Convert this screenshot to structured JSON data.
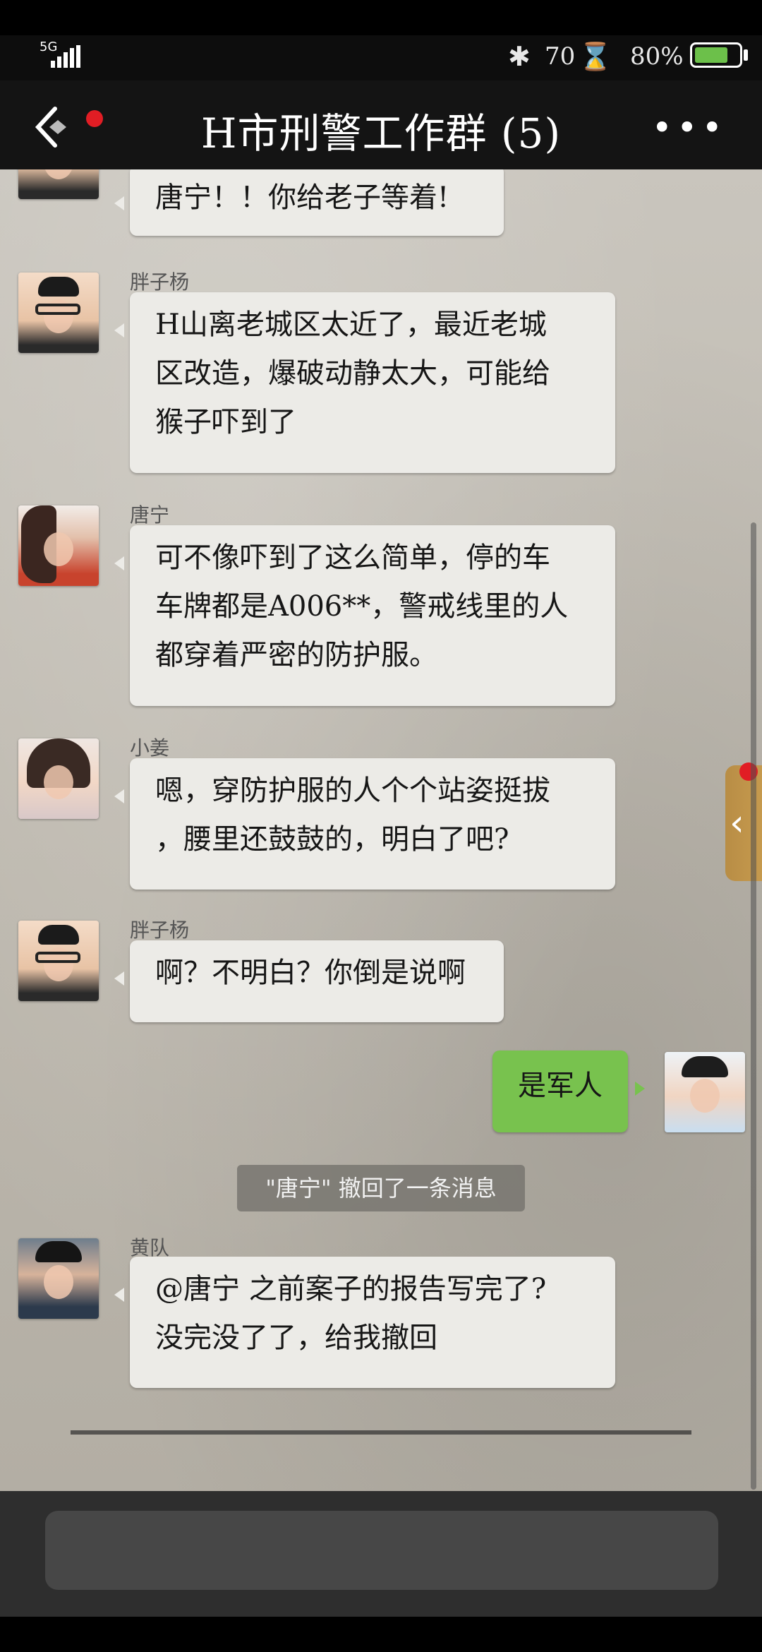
{
  "status_bar": {
    "network": "5G",
    "bluetooth_icon": "bluetooth-icon",
    "speed": "70",
    "hourglass_icon": "hourglass-icon",
    "battery_percent": "80%",
    "battery_level": 0.8
  },
  "header": {
    "title": "H市刑警工作群 (5)",
    "back_icon": "back-arrow-icon",
    "more_label": "•••"
  },
  "messages": [
    {
      "sender": "",
      "avatar": "avatar-pangziyang",
      "text_lines": [
        "唐宁！！你给老子等着!"
      ]
    },
    {
      "sender": "胖子杨",
      "avatar": "avatar-pangziyang",
      "text_lines": [
        "H山离老城区太近了，最近老城",
        "区改造，爆破动静太大，可能给",
        "猴子吓到了"
      ]
    },
    {
      "sender": "唐宁",
      "avatar": "avatar-tangning",
      "text_lines": [
        "可不像吓到了这么简单，停的车",
        "车牌都是A006**，警戒线里的人",
        "都穿着严密的防护服。"
      ]
    },
    {
      "sender": "小姜",
      "avatar": "avatar-xiaojiang",
      "text_lines": [
        "嗯，穿防护服的人个个站姿挺拔",
        "，腰里还鼓鼓的，明白了吧?"
      ]
    },
    {
      "sender": "胖子杨",
      "avatar": "avatar-pangziyang",
      "text_lines": [
        "啊？不明白？你倒是说啊"
      ]
    },
    {
      "sender": "",
      "avatar": "avatar-me",
      "text_lines": [
        "是军人"
      ],
      "self": true
    },
    {
      "sender": "黄队",
      "avatar": "avatar-huangdui",
      "text_lines": [
        "@唐宁 之前案子的报告写完了?",
        "没完没了了，给我撤回"
      ]
    }
  ],
  "system_note": "\"唐宁\" 撤回了一条消息",
  "side_tab": {
    "icon": "chevron-left-icon",
    "glyph": "‹"
  },
  "input": {
    "placeholder": ""
  },
  "colors": {
    "self_bubble": "#78c24e",
    "other_bubble": "#ecebe7",
    "header_bg": "#141414",
    "badge_red": "#e11d24",
    "battery_green": "#6cc04a"
  }
}
